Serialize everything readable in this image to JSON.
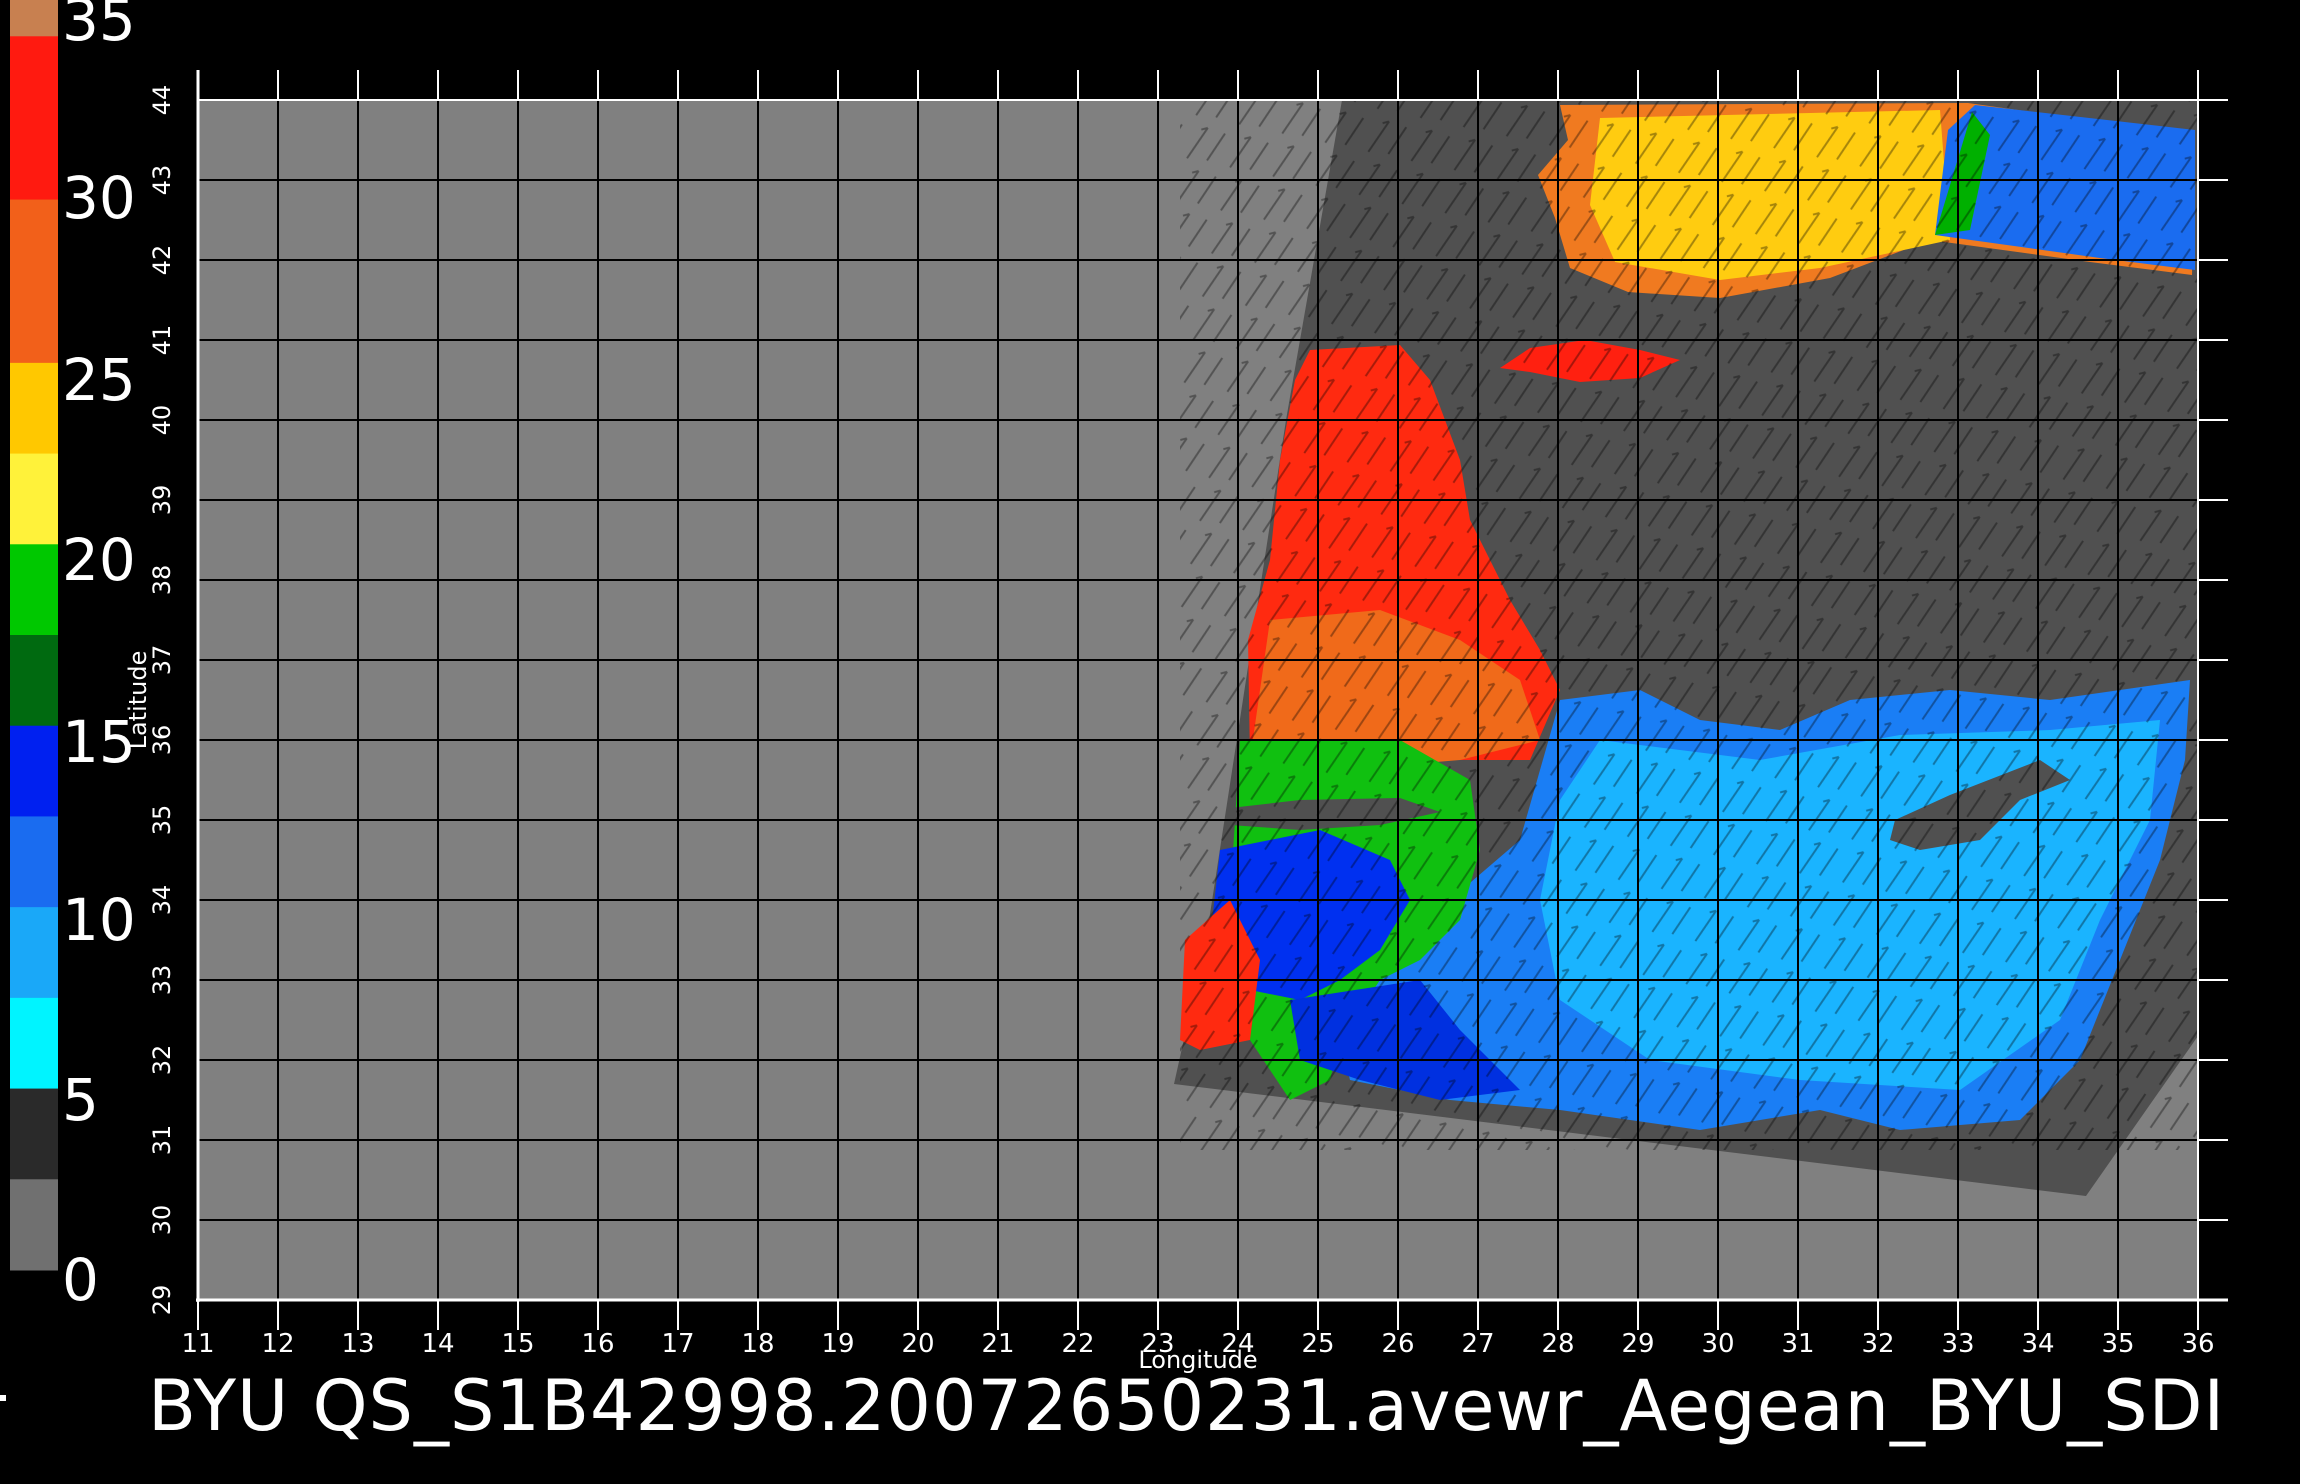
{
  "colorbar": {
    "labels": [
      "35",
      "30",
      "25",
      "20",
      "15",
      "10",
      "5",
      "0"
    ],
    "stops": [
      {
        "from": 35.0,
        "to": 34.0,
        "color": "#c88050"
      },
      {
        "from": 34.0,
        "to": 29.5,
        "color": "#ff1a10"
      },
      {
        "from": 29.5,
        "to": 25.0,
        "color": "#f2601a"
      },
      {
        "from": 25.0,
        "to": 22.5,
        "color": "#ffc800"
      },
      {
        "from": 22.5,
        "to": 20.0,
        "color": "#fff23a"
      },
      {
        "from": 20.0,
        "to": 17.5,
        "color": "#00c800"
      },
      {
        "from": 17.5,
        "to": 15.0,
        "color": "#006a10"
      },
      {
        "from": 15.0,
        "to": 12.5,
        "color": "#0020f0"
      },
      {
        "from": 12.5,
        "to": 10.0,
        "color": "#1a6cf0"
      },
      {
        "from": 10.0,
        "to": 7.5,
        "color": "#1aa8f8"
      },
      {
        "from": 7.5,
        "to": 5.0,
        "color": "#00f4ff"
      },
      {
        "from": 5.0,
        "to": 2.5,
        "color": "#2a2a2a"
      },
      {
        "from": 2.5,
        "to": 0.0,
        "color": "#707070"
      }
    ]
  },
  "map": {
    "xlabel": "Longitude",
    "ylabel": "Latitude",
    "lon_range": [
      11,
      36
    ],
    "lat_range": [
      29,
      44
    ],
    "lon_ticks": [
      "11",
      "12",
      "13",
      "14",
      "15",
      "16",
      "17",
      "18",
      "19",
      "20",
      "21",
      "22",
      "23",
      "24",
      "25",
      "26",
      "27",
      "28",
      "29",
      "30",
      "31",
      "32",
      "33",
      "34",
      "35",
      "36"
    ],
    "lat_ticks": [
      "29",
      "30",
      "31",
      "32",
      "33",
      "34",
      "35",
      "36",
      "37",
      "38",
      "39",
      "40",
      "41",
      "42",
      "43",
      "44"
    ],
    "colors": {
      "land": "#808080",
      "swath": "#505050",
      "grid": "#000000"
    },
    "swath_lonlat": [
      [
        25.3,
        44.0
      ],
      [
        36.0,
        44.0
      ],
      [
        36.0,
        32.3
      ],
      [
        34.6,
        30.3
      ],
      [
        23.2,
        31.7
      ],
      [
        23.6,
        33.5
      ],
      [
        24.6,
        40.0
      ]
    ]
  },
  "footer": {
    "title": "BYU  QS_S1B42998.20072650231.avewr_Aegean_BYU_SDI"
  }
}
